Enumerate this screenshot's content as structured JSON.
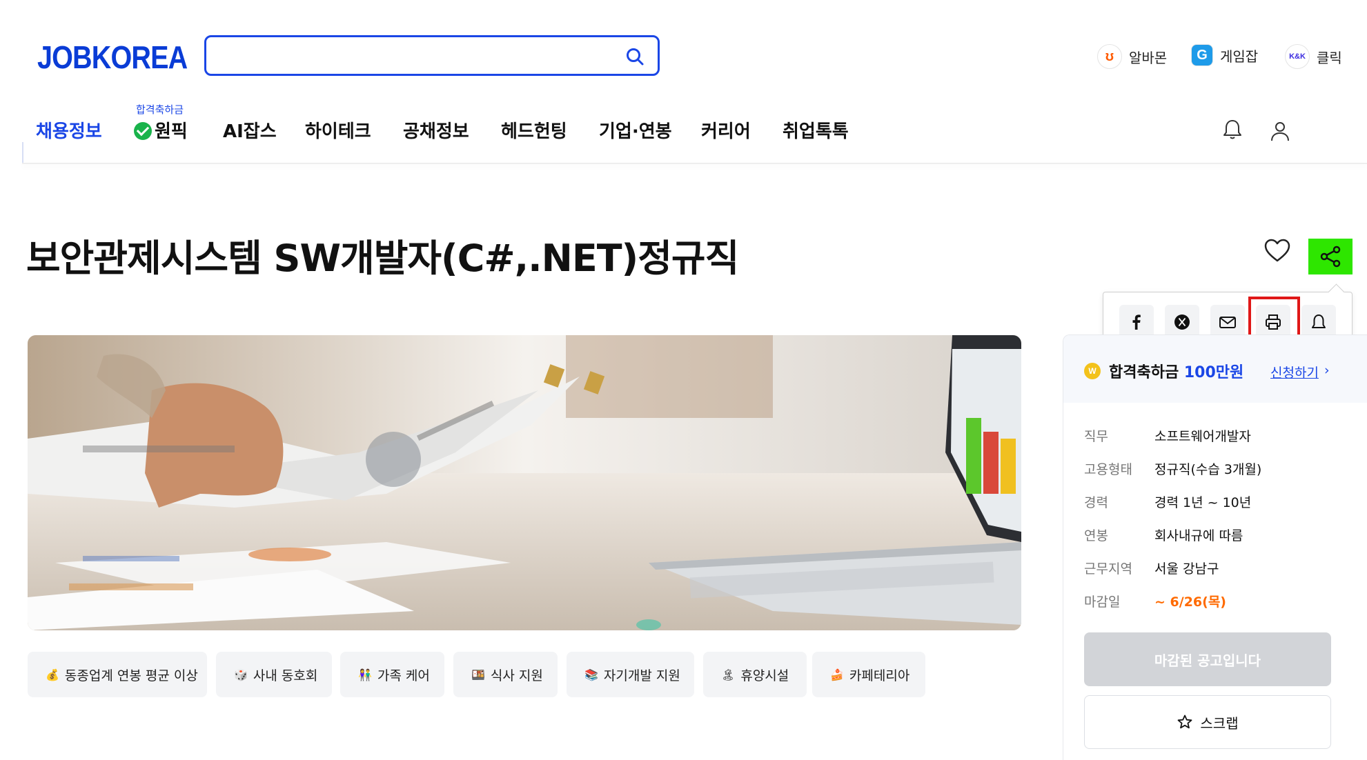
{
  "header": {
    "logo": "JOBKOREA",
    "search": {
      "placeholder": "",
      "value": ""
    },
    "family_sites": [
      {
        "badge": "ʊ",
        "label": "알바몬"
      },
      {
        "badge": "G",
        "label": "게임잡"
      },
      {
        "badge": "K&K",
        "label": "클릭"
      }
    ]
  },
  "nav": {
    "items": [
      {
        "label": "채용정보"
      },
      {
        "label": "원픽",
        "sup": "합격축하금"
      },
      {
        "label": "AI잡스"
      },
      {
        "label": "하이테크"
      },
      {
        "label": "공채정보"
      },
      {
        "label": "헤드헌팅"
      },
      {
        "label": "기업·연봉"
      },
      {
        "label": "커리어"
      },
      {
        "label": "취업톡톡"
      }
    ]
  },
  "job": {
    "title": "보안관제시스템 SW개발자(C#,.NET)정규직"
  },
  "share": {
    "options": [
      "facebook-icon",
      "x-icon",
      "mail-icon",
      "print-icon",
      "bell-icon"
    ]
  },
  "benefits": [
    {
      "emoji": "💰",
      "label": "동종업계 연봉 평균 이상"
    },
    {
      "emoji": "🎲",
      "label": "사내 동호회"
    },
    {
      "emoji": "👫",
      "label": "가족 케어"
    },
    {
      "emoji": "🍱",
      "label": "식사 지원"
    },
    {
      "emoji": "📚",
      "label": "자기개발 지원"
    },
    {
      "emoji": "🏝",
      "label": "휴양시설"
    },
    {
      "emoji": "🍰",
      "label": "카페테리아"
    }
  ],
  "panel": {
    "coin": "W",
    "bonus_label": "합격축하금",
    "bonus_amount": "100만원",
    "apply": "신청하기",
    "details": [
      {
        "key": "직무",
        "value": "소프트웨어개발자"
      },
      {
        "key": "고용형태",
        "value": "정규직(수습 3개월)"
      },
      {
        "key": "경력",
        "value": "경력 1년 ~ 10년"
      },
      {
        "key": "연봉",
        "value": "회사내규에 따름"
      },
      {
        "key": "근무지역",
        "value": "서울 강남구"
      },
      {
        "key": "마감일",
        "value": "~ 6/26(목)"
      }
    ],
    "closed_button": "마감된 공고입니다",
    "scrap_button": "스크랩"
  },
  "colors": {
    "brand": "#1a46e6",
    "share_highlight": "#2ee600",
    "deadline": "#ff6a00",
    "focus_box": "#e01818"
  }
}
